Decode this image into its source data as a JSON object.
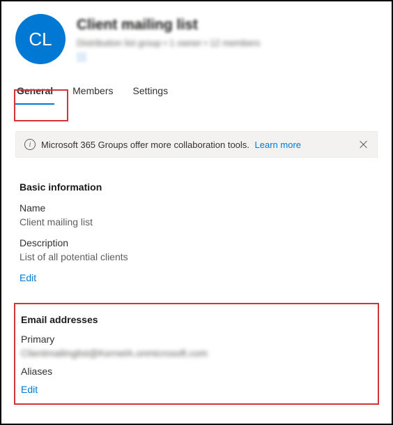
{
  "header": {
    "avatar_initials": "CL",
    "title": "Client mailing list",
    "subtitle": "Distribution list group • 1 owner • 12 members"
  },
  "tabs": {
    "general": "General",
    "members": "Members",
    "settings": "Settings"
  },
  "notice": {
    "text": "Microsoft 365 Groups offer more collaboration tools.",
    "link": "Learn more"
  },
  "basic": {
    "section_title": "Basic information",
    "name_label": "Name",
    "name_value": "Client mailing list",
    "desc_label": "Description",
    "desc_value": "List of all potential clients",
    "edit": "Edit"
  },
  "email": {
    "section_title": "Email addresses",
    "primary_label": "Primary",
    "primary_value": "Clientmailinglist@KernelA.onmicrosoft.com",
    "aliases_label": "Aliases",
    "edit": "Edit"
  }
}
